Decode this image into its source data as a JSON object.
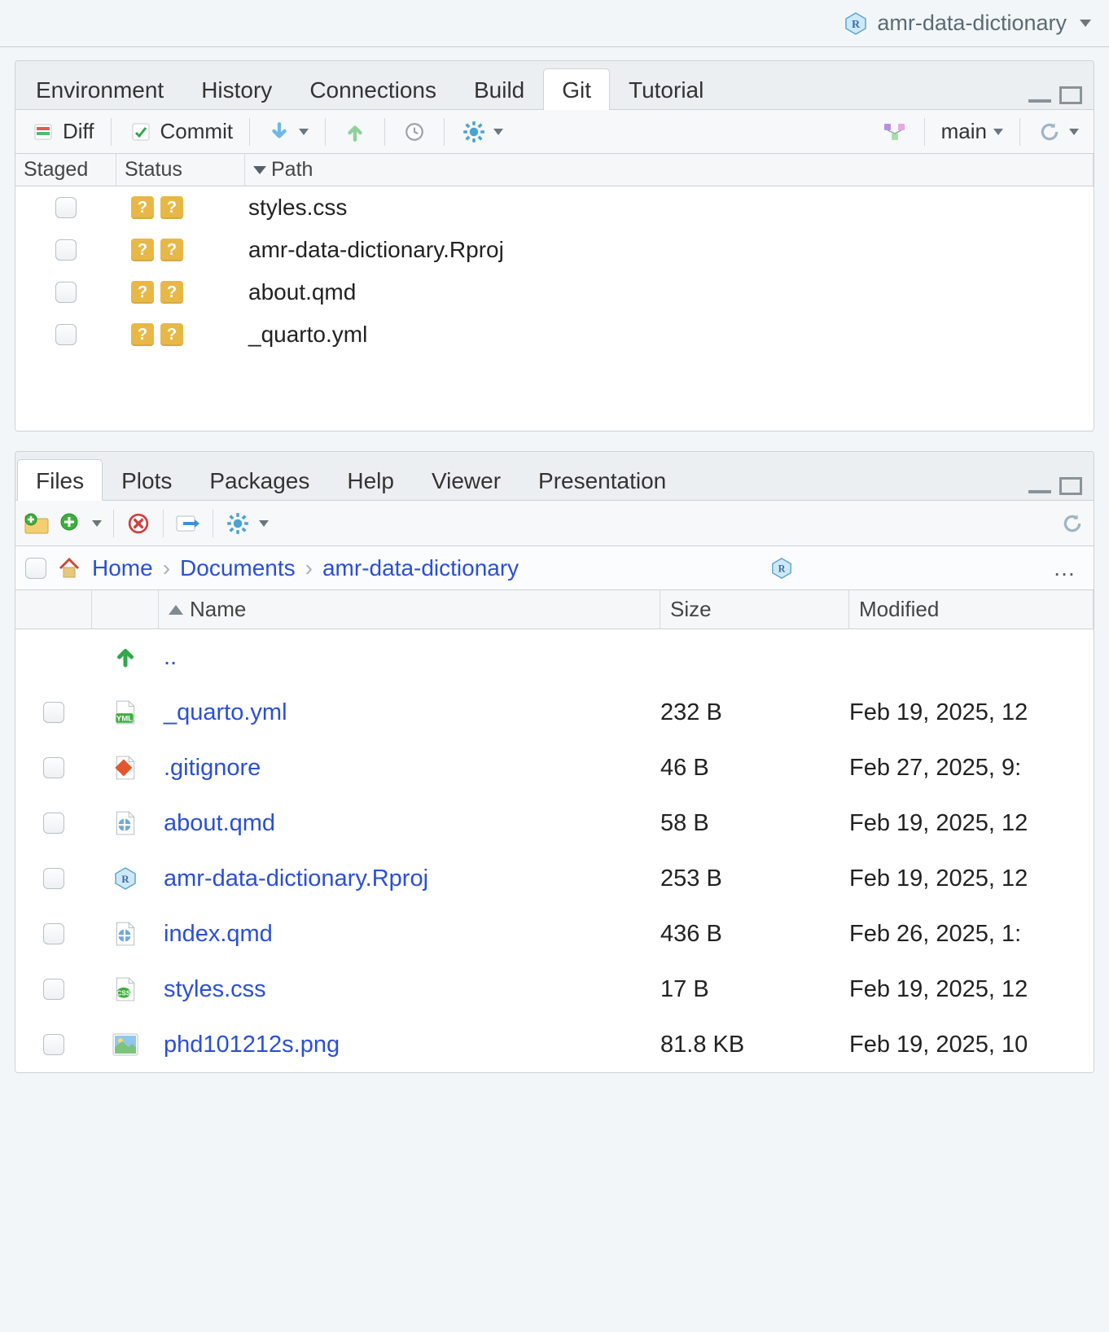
{
  "project": {
    "name": "amr-data-dictionary"
  },
  "upper": {
    "tabs": [
      "Environment",
      "History",
      "Connections",
      "Build",
      "Git",
      "Tutorial"
    ],
    "active_tab": "Git",
    "toolbar": {
      "diff": "Diff",
      "commit": "Commit",
      "branch": "main"
    },
    "columns": {
      "staged": "Staged",
      "status": "Status",
      "path": "Path"
    },
    "rows": [
      {
        "status": "??",
        "path": "styles.css"
      },
      {
        "status": "??",
        "path": "amr-data-dictionary.Rproj"
      },
      {
        "status": "??",
        "path": "about.qmd"
      },
      {
        "status": "??",
        "path": "_quarto.yml"
      }
    ]
  },
  "lower": {
    "tabs": [
      "Files",
      "Plots",
      "Packages",
      "Help",
      "Viewer",
      "Presentation"
    ],
    "active_tab": "Files",
    "breadcrumb": [
      "Home",
      "Documents",
      "amr-data-dictionary"
    ],
    "columns": {
      "name": "Name",
      "size": "Size",
      "modified": "Modified"
    },
    "updir": "..",
    "rows": [
      {
        "icon": "yml",
        "name": "_quarto.yml",
        "size": "232 B",
        "modified": "Feb 19, 2025, 12"
      },
      {
        "icon": "git",
        "name": ".gitignore",
        "size": "46 B",
        "modified": "Feb 27, 2025, 9:"
      },
      {
        "icon": "quarto",
        "name": "about.qmd",
        "size": "58 B",
        "modified": "Feb 19, 2025, 12"
      },
      {
        "icon": "rproj",
        "name": "amr-data-dictionary.Rproj",
        "size": "253 B",
        "modified": "Feb 19, 2025, 12"
      },
      {
        "icon": "quarto",
        "name": "index.qmd",
        "size": "436 B",
        "modified": "Feb 26, 2025, 1:"
      },
      {
        "icon": "css",
        "name": "styles.css",
        "size": "17 B",
        "modified": "Feb 19, 2025, 12"
      },
      {
        "icon": "image",
        "name": "phd101212s.png",
        "size": "81.8 KB",
        "modified": "Feb 19, 2025, 10"
      }
    ]
  }
}
